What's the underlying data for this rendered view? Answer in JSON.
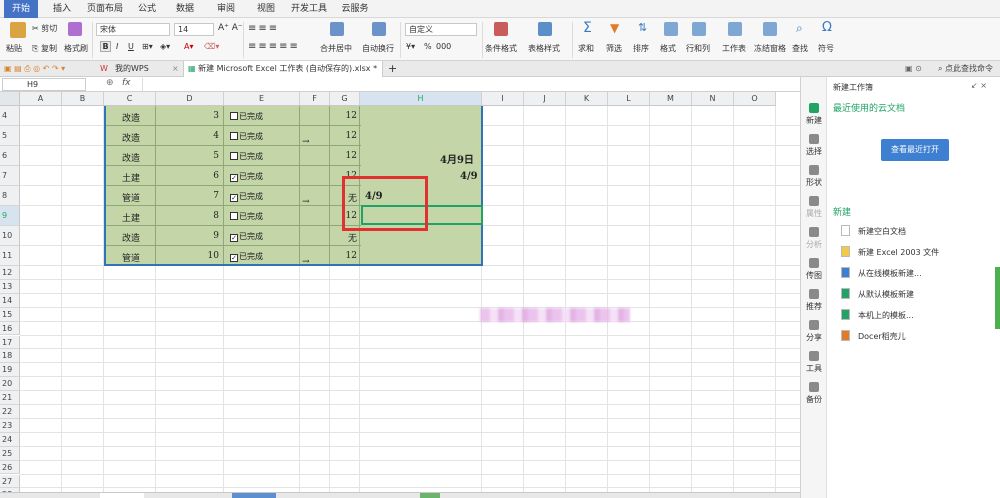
{
  "menu": {
    "tabs": [
      "开始",
      "插入",
      "页面布局",
      "公式",
      "数据",
      "审阅",
      "视图",
      "开发工具",
      "云服务"
    ],
    "active_index": 0
  },
  "ribbon": {
    "paste": "粘贴",
    "cut": "剪切",
    "copy": "复制",
    "format_painter": "格式刷",
    "font_name": "宋体",
    "font_size": "14",
    "bold": "B",
    "italic": "I",
    "underline": "U",
    "merge_center": "合并居中",
    "wrap_text": "自动换行",
    "number_format": "自定义",
    "percent": "%",
    "thousands": "000",
    "conditional_format": "条件格式",
    "table_style": "表格样式",
    "sum": "求和",
    "filter": "筛选",
    "sort": "排序",
    "format": "格式",
    "rows_cols": "行和列",
    "worksheet": "工作表",
    "freeze": "冻结窗格",
    "find": "查找",
    "symbol": "符号"
  },
  "doc_tabs": {
    "my_wps": "我的WPS",
    "file_title": "新建 Microsoft Excel 工作表 (自动保存的).xlsx *",
    "add": "+",
    "search_hint": "点此查找命令"
  },
  "formula_bar": {
    "name_box": "H9",
    "fx": "fx",
    "value": ""
  },
  "grid": {
    "columns": [
      "A",
      "B",
      "C",
      "D",
      "E",
      "F",
      "G",
      "H",
      "I",
      "J",
      "K",
      "L",
      "M",
      "N",
      "O"
    ],
    "active_column": "H",
    "rows": [
      4,
      5,
      6,
      7,
      8,
      9,
      10,
      11,
      12,
      13,
      14,
      15,
      16,
      17,
      18,
      19,
      20,
      21,
      22,
      23,
      24,
      25,
      26,
      27,
      28,
      29
    ],
    "active_row": 9,
    "data_rows": [
      {
        "row": 4,
        "type": "改造",
        "num": "3",
        "checked": false,
        "status": "已完成",
        "arrow": "",
        "g": "12"
      },
      {
        "row": 5,
        "type": "改造",
        "num": "4",
        "checked": false,
        "status": "已完成",
        "arrow": "→",
        "g": "12"
      },
      {
        "row": 6,
        "type": "改造",
        "num": "5",
        "checked": false,
        "status": "已完成",
        "arrow": "",
        "g": "12"
      },
      {
        "row": 7,
        "type": "土建",
        "num": "6",
        "checked": true,
        "status": "已完成",
        "arrow": "",
        "g": "12"
      },
      {
        "row": 8,
        "type": "管道",
        "num": "7",
        "checked": true,
        "status": "已完成",
        "arrow": "→",
        "g": "无"
      },
      {
        "row": 9,
        "type": "土建",
        "num": "8",
        "checked": false,
        "status": "已完成",
        "arrow": "",
        "g": "12"
      },
      {
        "row": 10,
        "type": "改造",
        "num": "9",
        "checked": true,
        "status": "已完成",
        "arrow": "",
        "g": "无"
      },
      {
        "row": 11,
        "type": "管道",
        "num": "10",
        "checked": true,
        "status": "已完成",
        "arrow": "→",
        "g": "12"
      }
    ],
    "h_values": {
      "h6": "4月9日",
      "h7": "4/9",
      "h8": "4/9"
    }
  },
  "task_pane": {
    "title": "新建工作簿",
    "recent_header": "最近使用的云文档",
    "open_recent_button": "查看最近打开",
    "new_header": "新建",
    "items": [
      "新建空白文档",
      "新建 Excel 2003 文件",
      "从在线模板新建...",
      "从默认模板新建",
      "本机上的模板...",
      "Docer稻壳儿"
    ],
    "side_buttons": [
      "新建",
      "选择",
      "形状",
      "属性",
      "分析",
      "传图",
      "推荐",
      "分享",
      "工具",
      "备份"
    ]
  },
  "colors": {
    "accent": "#4472c4",
    "cell_fill": "#c4d5a8",
    "table_border": "#2e75b6",
    "highlight": "#e03030",
    "active_green": "#21a366"
  }
}
